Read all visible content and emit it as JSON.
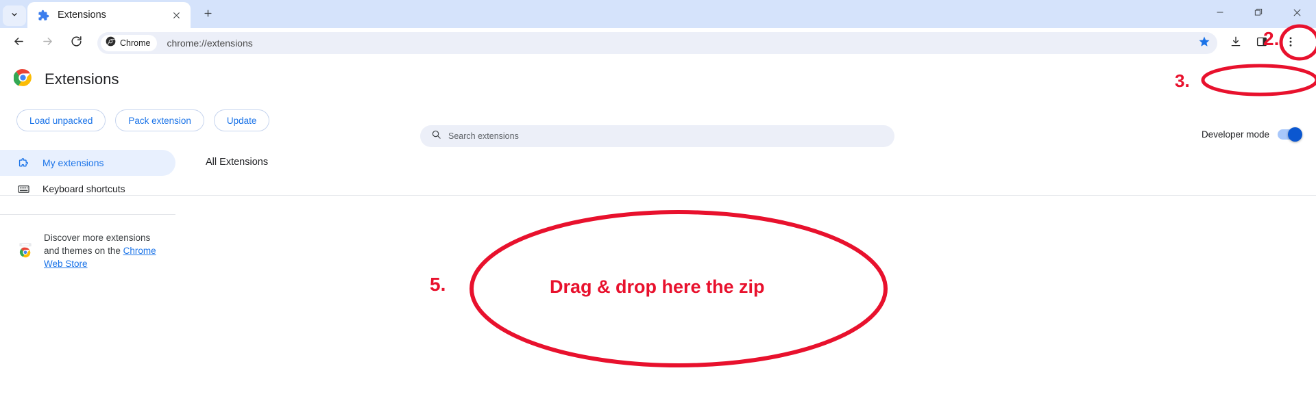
{
  "window": {
    "controls": [
      {
        "name": "minimize",
        "glyph": "minimize-icon"
      },
      {
        "name": "maximize",
        "glyph": "maximize-icon"
      },
      {
        "name": "close",
        "glyph": "close-icon"
      }
    ]
  },
  "tabstrip": {
    "tab_search_icon": "chevron-down-icon",
    "new_tab_icon": "plus-icon",
    "tabs": [
      {
        "title": "Extensions",
        "favicon": "puzzle-piece-icon",
        "close_icon": "close-icon",
        "active": true
      }
    ]
  },
  "toolbar": {
    "back_icon": "arrow-left-icon",
    "forward_icon": "arrow-right-icon",
    "reload_icon": "reload-icon",
    "chip_label": "Chrome",
    "chip_icon": "chrome-logo-icon",
    "url": "chrome://extensions",
    "bookmark_icon": "star-icon",
    "downloads_icon": "download-icon",
    "sidepanel_icon": "side-panel-icon",
    "menu_icon": "three-dot-menu-icon"
  },
  "page": {
    "title": "Extensions",
    "logo": "chrome-logo-icon",
    "search": {
      "placeholder": "Search extensions",
      "value": "",
      "icon": "search-icon"
    },
    "developer_mode": {
      "label": "Developer mode",
      "enabled": true
    },
    "actions": [
      {
        "label": "Load unpacked",
        "name": "load-unpacked-button"
      },
      {
        "label": "Pack extension",
        "name": "pack-extension-button"
      },
      {
        "label": "Update",
        "name": "update-button"
      }
    ],
    "sidebar": {
      "items": [
        {
          "label": "My extensions",
          "icon": "puzzle-piece-icon",
          "active": true
        },
        {
          "label": "Keyboard shortcuts",
          "icon": "keyboard-icon",
          "active": false
        }
      ],
      "discover": {
        "icon": "chrome-web-store-icon",
        "text_before": "Discover more extensions and themes on the ",
        "link_text": "Chrome Web Store",
        "text_after": ""
      }
    },
    "content": {
      "section_title": "All Extensions",
      "extensions": []
    }
  },
  "annotations": {
    "step_2": "2.",
    "step_3": "3.",
    "step_5": "5.",
    "drop_text": "Drag & drop here the zip",
    "color": "#e8112d"
  },
  "colors": {
    "tabstrip_bg": "#d5e3fb",
    "toolbar_bg": "#ffffff",
    "omnibox_bg": "#eceff8",
    "accent_blue": "#1a73e8",
    "toggle_on": "#0b57d0",
    "sidebar_active_bg": "#e8f0fe",
    "annotation_red": "#e8112d"
  }
}
